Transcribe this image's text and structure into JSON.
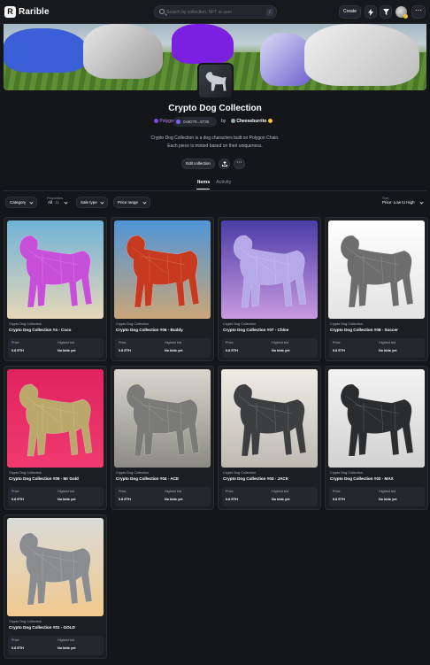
{
  "topbar": {
    "brand": "Rarible",
    "search_placeholder": "Search by collection, NFT or user",
    "search_kbd": "/",
    "create_label": "Create"
  },
  "collection": {
    "title": "Crypto Dog Collection",
    "chain": "Polygon",
    "address": "0x6D79...8735",
    "by": "by",
    "creator": "Cheeseburrito",
    "description_line1": "Crypto Dog Collection is a dog characters built on Polygon Chain.",
    "description_line2": "Each piece is minted based on their uniqueness.",
    "edit_label": "Edit collection"
  },
  "tabs": [
    "Items",
    "Activity"
  ],
  "filters": {
    "category": "Category",
    "properties_label": "Properties",
    "properties_value": "All",
    "properties_count": "11",
    "sale_type": "Sale type",
    "price_range": "Price range",
    "sort_label": "Sort",
    "sort_value": "Price: Low to High"
  },
  "price_labels": {
    "price": "Price",
    "highest_bid": "Highest bid"
  },
  "items": [
    {
      "collection": "Crypto Dog Collection",
      "name": "Crypto Dog Collection #4 - Coco",
      "price": "0.8 ETH",
      "bid": "No bids yet",
      "bg": [
        "#6fb3d6",
        "#e6d7b8"
      ],
      "dog": "#c84fd8"
    },
    {
      "collection": "Crypto Dog Collection",
      "name": "Crypto Dog Collection #06 - Buddy",
      "price": "0.8 ETH",
      "bid": "No bids yet",
      "bg": [
        "#4f95d8",
        "#c9a679"
      ],
      "dog": "#c73a1f"
    },
    {
      "collection": "Crypto Dog Collection",
      "name": "Crypto Dog Collection #07 - Chloe",
      "price": "0.8 ETH",
      "bid": "No bids yet",
      "bg": [
        "#4b3da8",
        "#c89ae0"
      ],
      "dog": "#b6a9e9"
    },
    {
      "collection": "Crypto Dog Collection",
      "name": "Crypto Dog Collection #08 - Soccer",
      "price": "0.8 ETH",
      "bid": "No bids yet",
      "bg": [
        "#ffffff",
        "#e3e3e3"
      ],
      "dog": "#6d6d6d"
    },
    {
      "collection": "Crypto Dog Collection",
      "name": "Crypto Dog Collection #09 - Mr Gold",
      "price": "0.8 ETH",
      "bid": "No bids yet",
      "bg": [
        "#e0235f",
        "#ef3a6f"
      ],
      "dog": "#b9a86a"
    },
    {
      "collection": "Crypto Dog Collection",
      "name": "Crypto Dog Collection #04 - ACE",
      "price": "0.8 ETH",
      "bid": "No bids yet",
      "bg": [
        "#d8d6cf",
        "#8b8a84"
      ],
      "dog": "#7a7a78"
    },
    {
      "collection": "Crypto Dog Collection",
      "name": "Crypto Dog Collection #03 - JACK",
      "price": "0.8 ETH",
      "bid": "No bids yet",
      "bg": [
        "#efece6",
        "#bdbab2"
      ],
      "dog": "#3d3e40"
    },
    {
      "collection": "Crypto Dog Collection",
      "name": "Crypto Dog Collection #02 - MAX",
      "price": "0.8 ETH",
      "bid": "No bids yet",
      "bg": [
        "#f3f3f3",
        "#d2d2d2"
      ],
      "dog": "#2b2c2e"
    },
    {
      "collection": "Crypto Dog Collection",
      "name": "Crypto Dog Collection #01 - GOLD",
      "price": "0.8 ETH",
      "bid": "No bids yet",
      "bg": [
        "#d9dbd8",
        "#f1c98d"
      ],
      "dog": "#8a8c90"
    }
  ]
}
